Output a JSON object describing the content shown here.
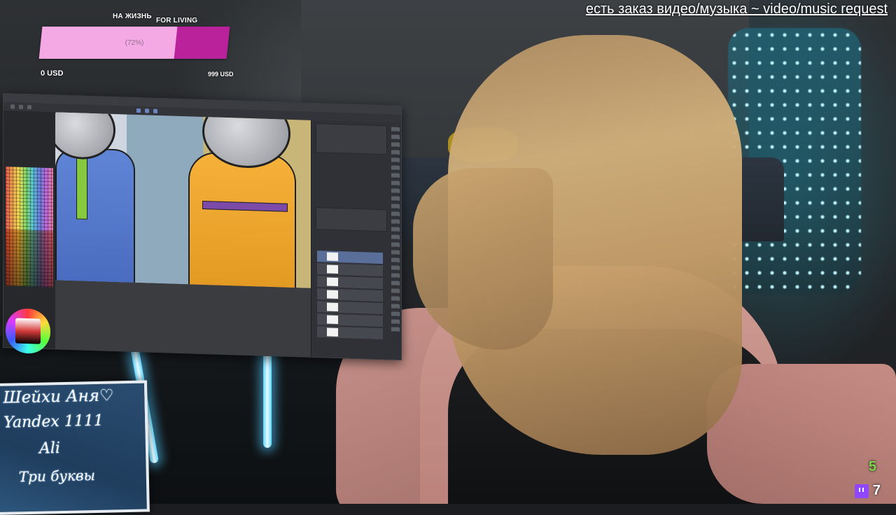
{
  "donation_goal": {
    "label_ru": "НА ЖИЗНЬ",
    "label_en": "FOR LIVING",
    "progress_percent": 72,
    "progress_text": "(72%)",
    "min_label": "0 USD",
    "max_label": "999 USD",
    "colors": {
      "fill": "#f5a9e4",
      "remaining": "#b9229a"
    }
  },
  "request_banner": "есть заказ видео/музыка ~ video/music request",
  "sign": {
    "lines": [
      "Шейхи Аня",
      "Yandex 1111",
      "Ali",
      "Три буквы"
    ],
    "icon": "heart-icon"
  },
  "counters": {
    "followers": "5",
    "viewers": "7",
    "viewers_icon": "twitch-icon",
    "colors": {
      "followers": "#7bd34a",
      "platform": "#9147ff"
    }
  },
  "app": {
    "icons": [
      "color-wheel-icon",
      "layer-thumbnail-icon"
    ]
  }
}
